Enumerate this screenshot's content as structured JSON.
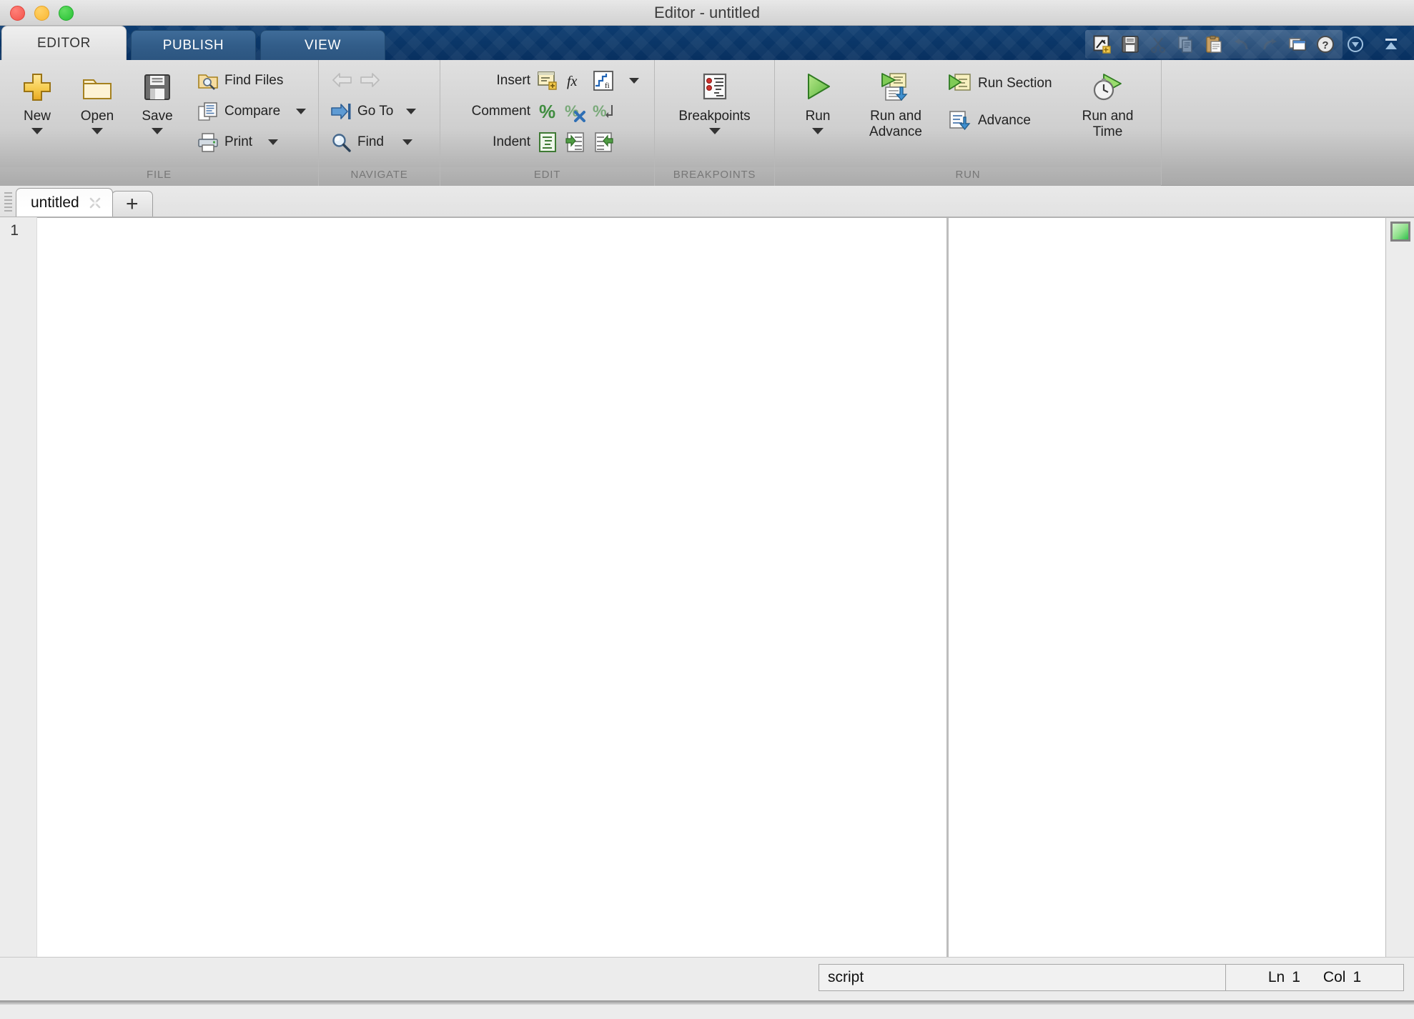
{
  "window": {
    "title": "Editor - untitled",
    "controls": [
      {
        "name": "close",
        "color": "#f3544c"
      },
      {
        "name": "minimize",
        "color": "#fab733"
      },
      {
        "name": "maximize",
        "color": "#28c034"
      }
    ]
  },
  "ribbon_tabs": [
    {
      "id": "editor",
      "label": "EDITOR",
      "active": true
    },
    {
      "id": "publish",
      "label": "PUBLISH",
      "active": false
    },
    {
      "id": "view",
      "label": "VIEW",
      "active": false
    }
  ],
  "quick_access": [
    {
      "id": "new-script",
      "icon": "new-script-icon",
      "enabled": true
    },
    {
      "id": "save",
      "icon": "save-icon",
      "enabled": true
    },
    {
      "id": "cut",
      "icon": "scissors-icon",
      "enabled": false
    },
    {
      "id": "copy",
      "icon": "copy-icon",
      "enabled": false
    },
    {
      "id": "paste",
      "icon": "paste-icon",
      "enabled": true
    },
    {
      "id": "undo",
      "icon": "undo-icon",
      "enabled": false
    },
    {
      "id": "redo",
      "icon": "redo-icon",
      "enabled": false
    },
    {
      "id": "switch-windows",
      "icon": "windows-icon",
      "enabled": true
    },
    {
      "id": "help",
      "icon": "help-icon",
      "enabled": true
    }
  ],
  "quick_access_right": [
    {
      "id": "search-docs",
      "icon": "search-docs-icon"
    },
    {
      "id": "minimize-ribbon",
      "icon": "collapse-ribbon-icon"
    }
  ],
  "groups": [
    {
      "id": "file",
      "label": "FILE",
      "big_buttons": [
        {
          "id": "new",
          "label": "New",
          "icon": "new-plus-icon",
          "has_menu": true
        },
        {
          "id": "open",
          "label": "Open",
          "icon": "folder-icon",
          "has_menu": true
        },
        {
          "id": "save",
          "label": "Save",
          "icon": "floppy-icon",
          "has_menu": true
        }
      ],
      "small_buttons": [
        {
          "id": "find-files",
          "label": "Find Files",
          "icon": "find-files-icon",
          "has_menu": false
        },
        {
          "id": "compare",
          "label": "Compare",
          "icon": "compare-icon",
          "has_menu": true
        },
        {
          "id": "print",
          "label": "Print",
          "icon": "printer-icon",
          "has_menu": true
        }
      ]
    },
    {
      "id": "navigate",
      "label": "NAVIGATE",
      "small_buttons": [
        {
          "id": "back",
          "label": "",
          "icon": "arrow-left-icon",
          "enabled": false
        },
        {
          "id": "forward",
          "label": "",
          "icon": "arrow-right-icon",
          "enabled": false
        },
        {
          "id": "go-to",
          "label": "Go To",
          "icon": "go-to-icon",
          "has_menu": true
        },
        {
          "id": "find",
          "label": "Find",
          "icon": "magnifier-icon",
          "has_menu": true
        }
      ]
    },
    {
      "id": "edit",
      "label": "EDIT",
      "rows": [
        {
          "id": "insert",
          "label": "Insert",
          "has_menu": true,
          "icons": [
            {
              "id": "insert-section",
              "icon": "insert-section-icon"
            },
            {
              "id": "insert-function",
              "icon": "fx-icon"
            },
            {
              "id": "insert-plot",
              "icon": "insert-plot-icon"
            }
          ]
        },
        {
          "id": "comment",
          "label": "Comment",
          "has_menu": false,
          "icons": [
            {
              "id": "comment-toggle",
              "icon": "percent-icon"
            },
            {
              "id": "uncomment",
              "icon": "percent-delete-icon"
            },
            {
              "id": "wrap-comments",
              "icon": "percent-wrap-icon"
            }
          ]
        },
        {
          "id": "indent",
          "label": "Indent",
          "has_menu": false,
          "icons": [
            {
              "id": "smart-indent",
              "icon": "smart-indent-icon"
            },
            {
              "id": "increase-indent",
              "icon": "indent-right-icon"
            },
            {
              "id": "decrease-indent",
              "icon": "indent-left-icon"
            }
          ]
        }
      ]
    },
    {
      "id": "breakpoints",
      "label": "BREAKPOINTS",
      "big_buttons": [
        {
          "id": "breakpoints",
          "label": "Breakpoints",
          "icon": "breakpoints-icon",
          "has_menu": true
        }
      ]
    },
    {
      "id": "run",
      "label": "RUN",
      "big_buttons": [
        {
          "id": "run",
          "label": "Run",
          "icon": "run-play-icon",
          "has_menu": true
        },
        {
          "id": "run-and-advance",
          "label": "Run and\nAdvance",
          "label_l1": "Run and",
          "label_l2": "Advance",
          "icon": "run-advance-icon",
          "has_menu": false
        },
        {
          "id": "run-and-time",
          "label": "Run and\nTime",
          "label_l1": "Run and",
          "label_l2": "Time",
          "icon": "run-time-icon",
          "has_menu": false
        }
      ],
      "small_buttons": [
        {
          "id": "run-section",
          "label": "Run Section",
          "icon": "run-section-icon"
        },
        {
          "id": "advance",
          "label": "Advance",
          "icon": "advance-icon"
        }
      ]
    }
  ],
  "file_tabs": {
    "tabs": [
      {
        "id": "untitled",
        "label": "untitled",
        "active": true,
        "close_icon": "close-x-icon"
      }
    ],
    "new_tab_label": "+"
  },
  "editor": {
    "line_numbers": [
      "1"
    ],
    "content": "",
    "analyzer_status_color": "#2fbf4c"
  },
  "status_bar": {
    "file_type": "script",
    "line_key": "Ln",
    "line_value": "1",
    "col_key": "Col",
    "col_value": "1"
  },
  "colors": {
    "ribbon_header_blue": "#0a3566",
    "tab_inactive_blue": "#325d89",
    "ribbon_body": "#cfcfcf",
    "editor_bg": "#ffffff",
    "gutter_bg": "#ececec",
    "accent_green": "#2fbf4c"
  }
}
